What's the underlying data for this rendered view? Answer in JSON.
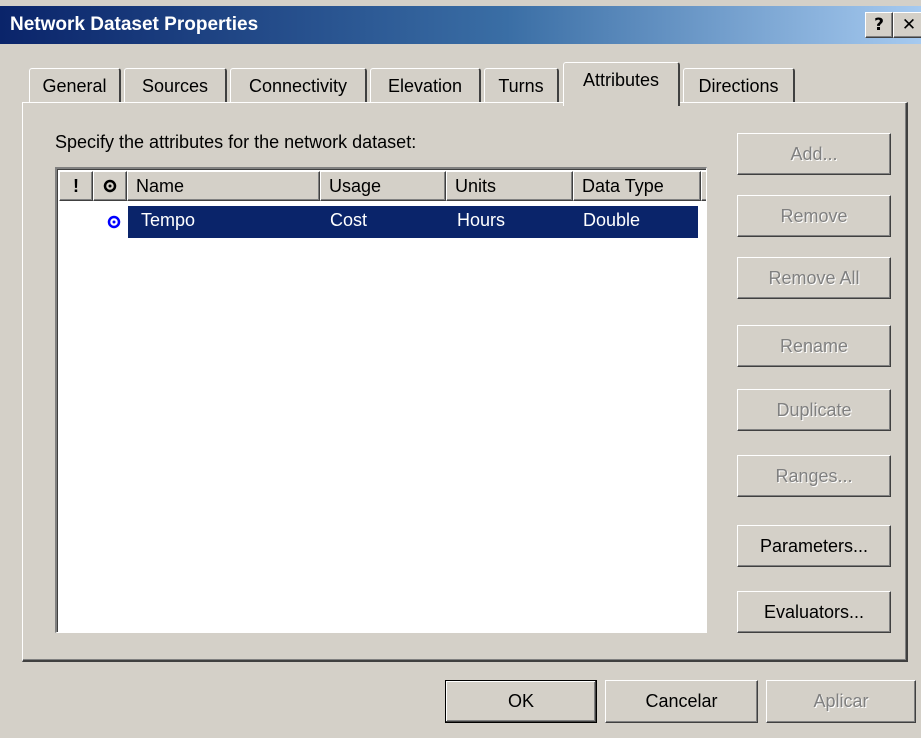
{
  "window": {
    "title": "Network Dataset Properties",
    "help_glyph": "?",
    "close_glyph": "✕"
  },
  "tabs": [
    {
      "label": "General",
      "active": false
    },
    {
      "label": "Sources",
      "active": false
    },
    {
      "label": "Connectivity",
      "active": false
    },
    {
      "label": "Elevation",
      "active": false
    },
    {
      "label": "Turns",
      "active": false
    },
    {
      "label": "Attributes",
      "active": true
    },
    {
      "label": "Directions",
      "active": false
    }
  ],
  "attributes": {
    "instruction": "Specify the attributes for the network dataset:",
    "columns": {
      "warning": "!",
      "default": "default-marker-icon",
      "name": "Name",
      "usage": "Usage",
      "units": "Units",
      "data_type": "Data Type"
    },
    "rows": [
      {
        "name": "Tempo",
        "usage": "Cost",
        "units": "Hours",
        "data_type": "Double",
        "selected": true,
        "default_icon": "default-marker-icon"
      }
    ]
  },
  "side_buttons": {
    "add": {
      "label": "Add...",
      "enabled": false
    },
    "remove": {
      "label": "Remove",
      "enabled": false
    },
    "remove_all": {
      "label": "Remove All",
      "enabled": false
    },
    "rename": {
      "label": "Rename",
      "enabled": false
    },
    "duplicate": {
      "label": "Duplicate",
      "enabled": false
    },
    "ranges": {
      "label": "Ranges...",
      "enabled": false
    },
    "parameters": {
      "label": "Parameters...",
      "enabled": true
    },
    "evaluators": {
      "label": "Evaluators...",
      "enabled": true
    }
  },
  "dialog_buttons": {
    "ok": {
      "label": "OK",
      "enabled": true
    },
    "cancel": {
      "label": "Cancelar",
      "enabled": true
    },
    "apply": {
      "label": "Aplicar",
      "enabled": false
    }
  },
  "colors": {
    "face": "#d4d0c8",
    "selection": "#0a246a",
    "title_start": "#0a246a",
    "title_end": "#a6caf0",
    "default_marker": "#0000ff"
  }
}
